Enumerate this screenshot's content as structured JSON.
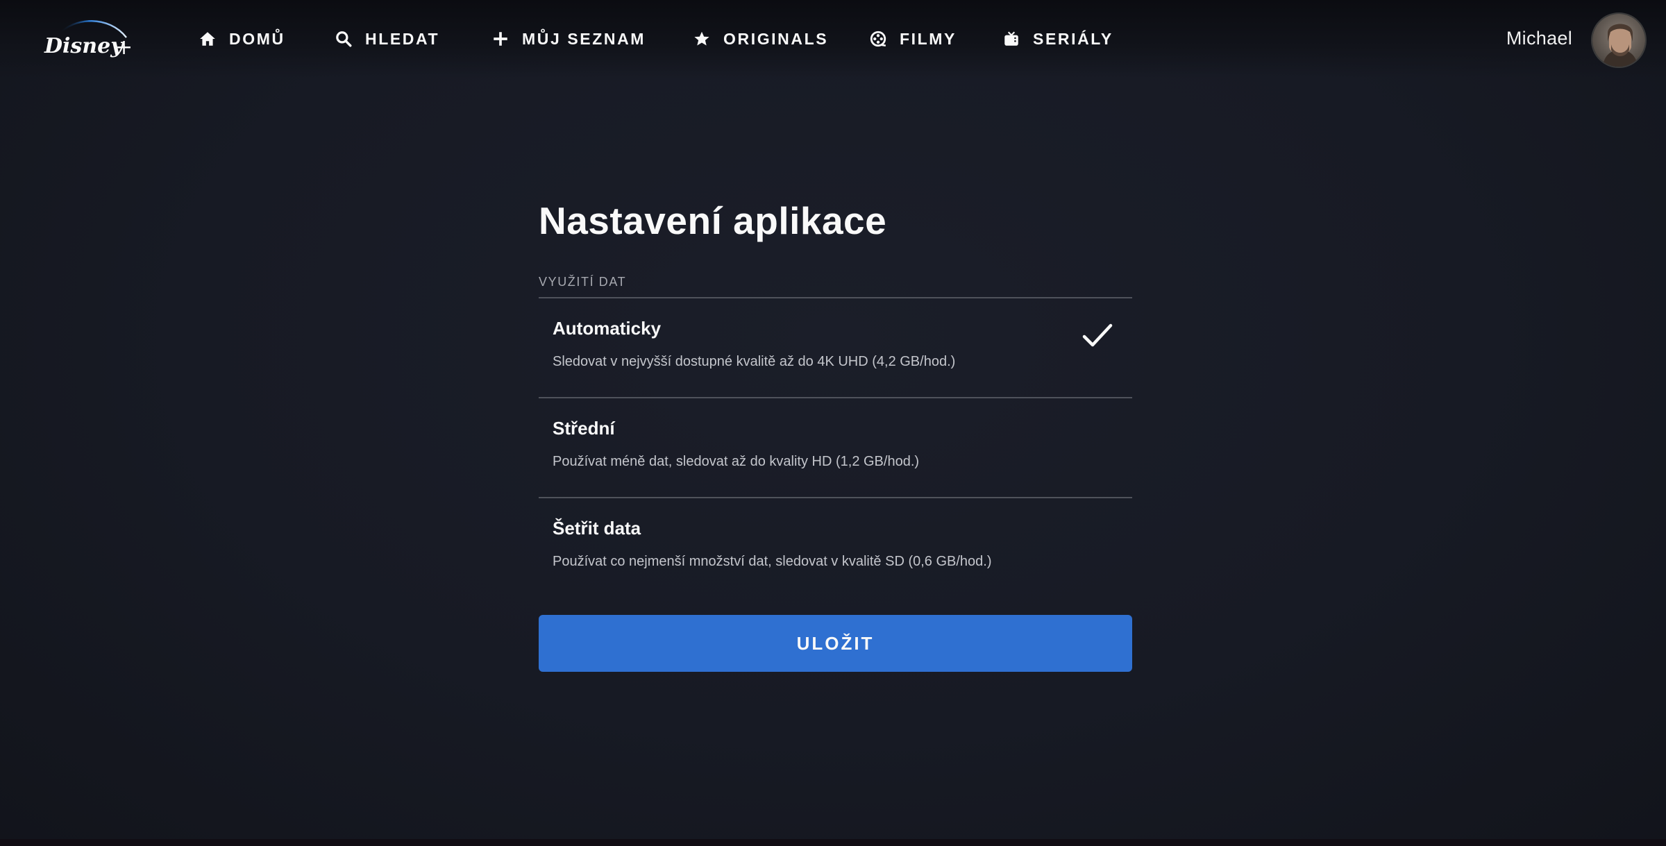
{
  "app": {
    "logo_alt": "Disney+",
    "brand_color": "#2f70d1"
  },
  "nav": {
    "items": [
      {
        "label": "DOMŮ",
        "icon": "home-icon"
      },
      {
        "label": "HLEDAT",
        "icon": "search-icon"
      },
      {
        "label": "MŮJ SEZNAM",
        "icon": "plus-icon"
      },
      {
        "label": "ORIGINALS",
        "icon": "star-icon"
      },
      {
        "label": "FILMY",
        "icon": "film-reel-icon"
      },
      {
        "label": "SERIÁLY",
        "icon": "tv-icon"
      }
    ]
  },
  "user": {
    "name": "Michael",
    "avatar_icon": "user-avatar"
  },
  "settings": {
    "title": "Nastavení aplikace",
    "section_label": "VYUŽITÍ DAT",
    "options": [
      {
        "title": "Automaticky",
        "description": "Sledovat v nejvyšší dostupné kvalitě až do 4K UHD (4,2 GB/hod.)",
        "selected": true
      },
      {
        "title": "Střední",
        "description": "Používat méně dat, sledovat až do kvality HD (1,2 GB/hod.)",
        "selected": false
      },
      {
        "title": "Šetřit data",
        "description": "Používat co nejmenší množství dat, sledovat v kvalitě SD (0,6 GB/hod.)",
        "selected": false
      }
    ],
    "save_label": "ULOŽIT"
  }
}
